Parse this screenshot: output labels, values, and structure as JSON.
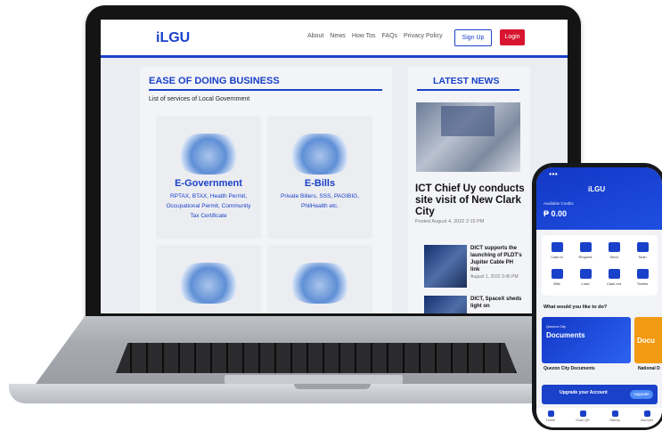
{
  "site": {
    "logo": "iLGU",
    "nav": [
      "About",
      "News",
      "How Tos",
      "FAQs",
      "Privacy Policy"
    ],
    "signup_label": "Sign Up",
    "login_label": "Login"
  },
  "ease": {
    "title": "EASE OF DOING BUSINESS",
    "subtitle": "List of services of Local Government",
    "cards": [
      {
        "title": "E-Government",
        "desc": "RPTAX, BTAX, Health Permit, Occupational Permit, Community Tax Certificate"
      },
      {
        "title": "E-Bills",
        "desc": "Private Billers, SSS, PAGIBIG, PhilHealth etc."
      }
    ]
  },
  "news": {
    "title": "LATEST NEWS",
    "headline": "ICT Chief Uy conducts site visit of New Clark City",
    "posted": "Posted August 4, 2022 2:15 PM",
    "items": [
      {
        "title": "DICT supports the launching of PLDT's Jupiter Cable PH link",
        "date": "August 1, 2022 3:45 PM"
      },
      {
        "title": "DICT, SpaceX sheds light on",
        "date": ""
      }
    ]
  },
  "phone": {
    "logo": "iLGU",
    "credit_label": "Available Credits",
    "balance": "₱ 0.00",
    "tiles": [
      "Cash in",
      "Request",
      "Send",
      "Scan",
      "Bills",
      "Load",
      "Cash out",
      "Tickets"
    ],
    "question": "What would you like to do?",
    "banner_small": "Quezon City",
    "banner_big": "Documents",
    "banner2_big": "Docu",
    "card_title": "Quezon City Documents",
    "card_title2": "National D",
    "upgrade_text": "Upgrade your Account",
    "upgrade_btn": "Upgrade",
    "tabs": [
      "Home",
      "Scan QR",
      "History",
      "Account"
    ]
  }
}
